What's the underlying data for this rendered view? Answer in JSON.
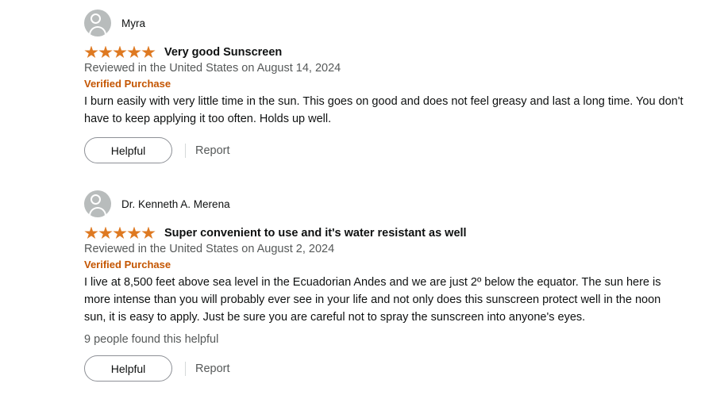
{
  "reviews": [
    {
      "reviewer": "Myra",
      "rating": 5,
      "title": "Very good Sunscreen",
      "date_line": "Reviewed in the United States on August 14, 2024",
      "verified": "Verified Purchase",
      "body": "I burn easily with very little time in the sun. This goes on good and does not feel greasy and last a long time. You don't have to keep applying it too often. Holds up well.",
      "helpful_label": "Helpful",
      "report_label": "Report"
    },
    {
      "reviewer": "Dr. Kenneth A. Merena",
      "rating": 5,
      "title": "Super convenient to use and it's water resistant as well",
      "date_line": "Reviewed in the United States on August 2, 2024",
      "verified": "Verified Purchase",
      "body": "I live at 8,500 feet above sea level in the Ecuadorian Andes and we are just 2º below the equator. The sun here is more intense than you will probably ever see in your life and not only does this sunscreen protect well in the noon sun, it is easy to apply. Just be sure you are careful not to spray the sunscreen into anyone's eyes.",
      "helpful_count": "9 people found this helpful",
      "helpful_label": "Helpful",
      "report_label": "Report"
    }
  ],
  "colors": {
    "star": "#de7921",
    "verified": "#c45500",
    "secondary_text": "#565959"
  }
}
